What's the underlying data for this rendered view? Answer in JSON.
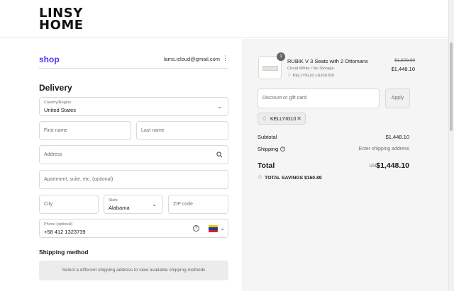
{
  "brand": {
    "line1": "LINSY",
    "line2": "HOME"
  },
  "shop": {
    "logo": "shop",
    "email": "lams.icloud@gmail.com",
    "menu_icon": "kebab-icon"
  },
  "delivery": {
    "heading": "Delivery",
    "country": {
      "label": "Country/Region",
      "value": "United States"
    },
    "first_name": {
      "placeholder": "First name"
    },
    "last_name": {
      "placeholder": "Last name"
    },
    "address": {
      "placeholder": "Address"
    },
    "apartment": {
      "placeholder": "Apartment, suite, etc. (optional)"
    },
    "city": {
      "placeholder": "City"
    },
    "state": {
      "label": "State",
      "value": "Alabama"
    },
    "zip": {
      "placeholder": "ZIP code"
    },
    "phone": {
      "label": "Phone (optional)",
      "value": "+58 412 1323739",
      "help": "?"
    }
  },
  "shipping_method": {
    "heading": "Shipping method",
    "message": "Select a different shipping address to view available shipping methods"
  },
  "order": {
    "item": {
      "quantity": "1",
      "name": "RUBIK V 3 Seats with 2 Ottomans",
      "variant": "Cloud White / No Storage",
      "discount": "KELLYIG10 (-$160.89)",
      "price_original": "$1,609.99",
      "price": "$1,448.10"
    },
    "discount_placeholder": "Discount or gift card",
    "apply_label": "Apply",
    "applied_code": "KELLYIG10",
    "subtotal_label": "Subtotal",
    "subtotal_value": "$1,448.10",
    "shipping_label": "Shipping",
    "shipping_value": "Enter shipping address",
    "total_label": "Total",
    "currency": "USD",
    "total_value": "$1,448.10",
    "savings_label": "TOTAL SAVINGS",
    "savings_value": "$160.89"
  },
  "colors": {
    "shop_purple": "#5a31f4",
    "right_panel_bg": "#f5f5f5"
  }
}
